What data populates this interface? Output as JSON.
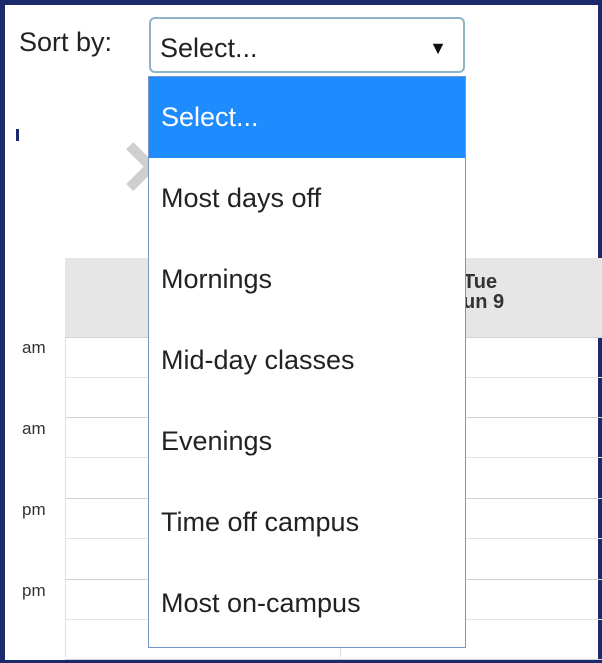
{
  "sort": {
    "label": "Sort by:",
    "current_value": "Select...",
    "options": [
      {
        "label": "Select...",
        "selected": true
      },
      {
        "label": "Most days off",
        "selected": false
      },
      {
        "label": "Mornings",
        "selected": false
      },
      {
        "label": "Mid-day classes",
        "selected": false
      },
      {
        "label": "Evenings",
        "selected": false
      },
      {
        "label": "Time off campus",
        "selected": false
      },
      {
        "label": "Most on-campus",
        "selected": false
      }
    ]
  },
  "calendar": {
    "day_header": {
      "weekday": "Tue",
      "date": "un 9"
    },
    "time_labels": [
      "am",
      "am",
      "pm",
      "pm"
    ]
  },
  "icons": {
    "select_arrow": "caret-down-icon",
    "close": "close-icon"
  },
  "colors": {
    "frame": "#1c2a6b",
    "selected_option_bg": "#1e8cff",
    "select_border": "#8fb3c6"
  }
}
